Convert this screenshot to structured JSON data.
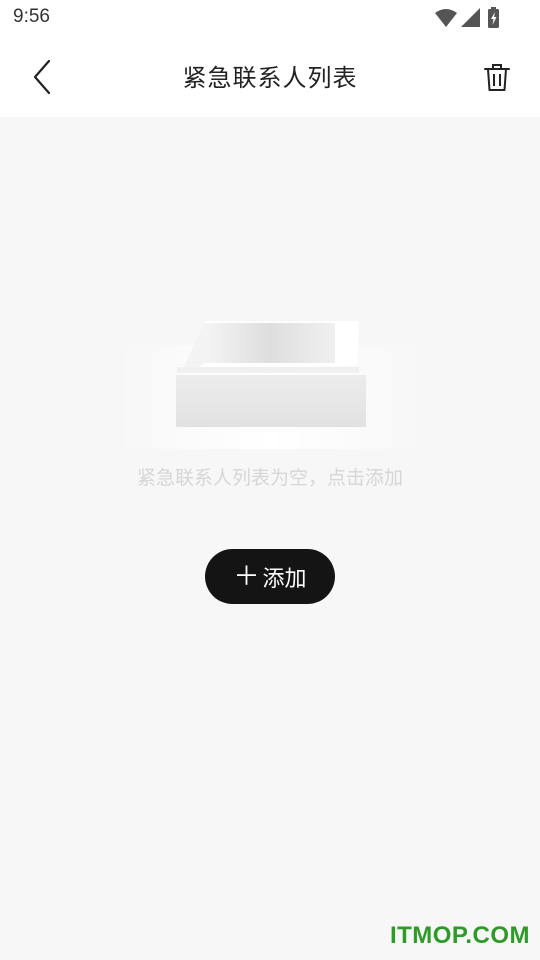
{
  "status_bar": {
    "time": "9:56",
    "icons": [
      "wifi-icon",
      "cell-signal-icon",
      "battery-charging-icon"
    ]
  },
  "header": {
    "title": "紧急联系人列表",
    "back_icon": "chevron-left-icon",
    "delete_icon": "trash-icon"
  },
  "empty_state": {
    "illustration": "empty-box-icon",
    "message": "紧急联系人列表为空，点击添加"
  },
  "actions": {
    "add_icon": "＋",
    "add_label": "添加"
  },
  "watermark": {
    "text": "ITMOP.COM",
    "color": "#2f9a2a"
  },
  "colors": {
    "background": "#f7f7f7",
    "header_background": "#ffffff",
    "button_background": "#141414",
    "empty_text": "#d6d6d6"
  }
}
